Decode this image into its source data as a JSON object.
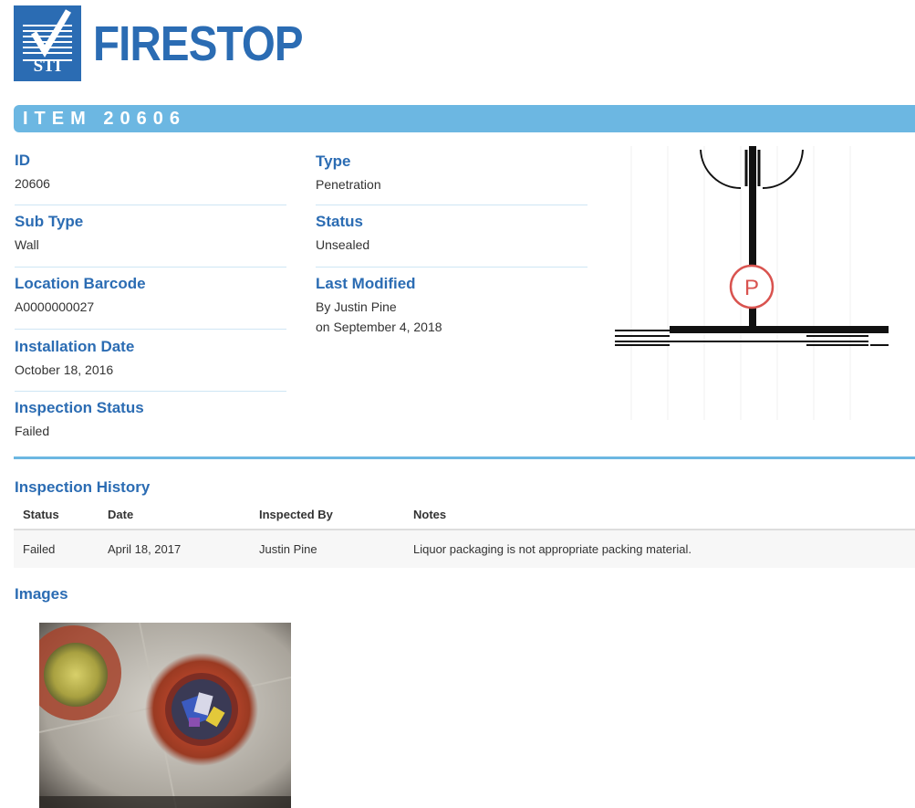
{
  "header": {
    "logo_mark_text": "STI",
    "logo_word": "FIRESTOP",
    "brand_color": "#2b6cb3",
    "accent_color": "#6cb7e2"
  },
  "banner": {
    "title": "ITEM 20606"
  },
  "fields": {
    "id": {
      "label": "ID",
      "value": "20606"
    },
    "sub_type": {
      "label": "Sub Type",
      "value": "Wall"
    },
    "location_barcode": {
      "label": "Location Barcode",
      "value": "A0000000027"
    },
    "installation_date": {
      "label": "Installation Date",
      "value": "October 18, 2016"
    },
    "inspection_status": {
      "label": "Inspection Status",
      "value": "Failed"
    },
    "type": {
      "label": "Type",
      "value": "Penetration"
    },
    "status": {
      "label": "Status",
      "value": "Unsealed"
    },
    "last_modified": {
      "label": "Last Modified",
      "by": "By Justin Pine",
      "on": "on September 4, 2018"
    }
  },
  "diagram": {
    "marker_label": "P",
    "marker_color": "#d9534f",
    "marker_icon": "penetration-marker-icon"
  },
  "inspection_history": {
    "title": "Inspection History",
    "columns": [
      "Status",
      "Date",
      "Inspected By",
      "Notes"
    ],
    "rows": [
      [
        "Failed",
        "April 18, 2017",
        "Justin Pine",
        "Liquor packaging is not appropriate packing material."
      ]
    ]
  },
  "images": {
    "title": "Images"
  }
}
